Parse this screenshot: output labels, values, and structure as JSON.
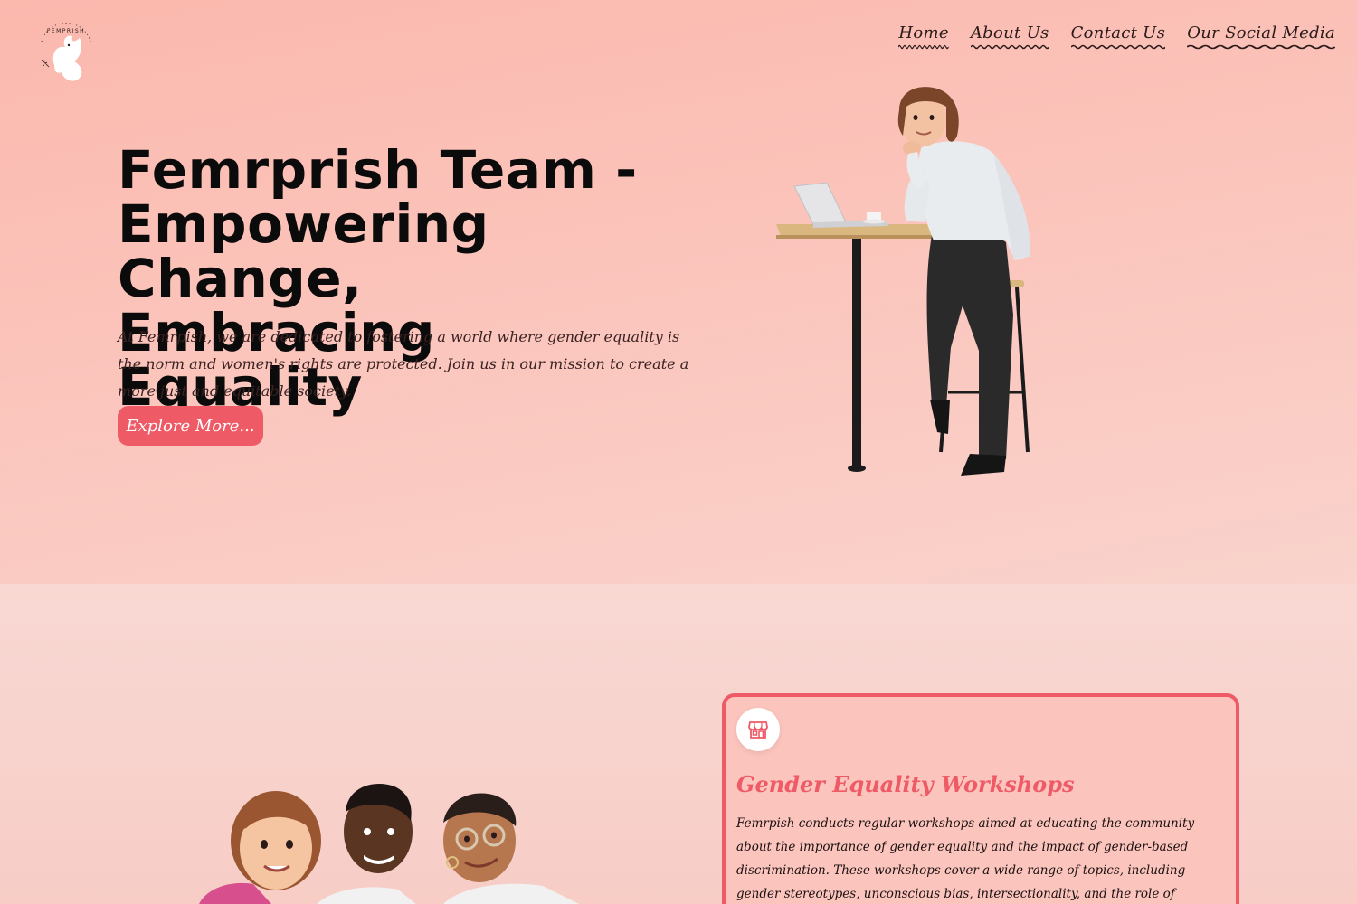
{
  "brand": {
    "logo_icon": "dove-icon",
    "logo_text": "FEMPRISH"
  },
  "nav": {
    "items": [
      {
        "label": "Home"
      },
      {
        "label": "About Us"
      },
      {
        "label": "Contact Us"
      },
      {
        "label": "Our Social Media"
      }
    ]
  },
  "hero": {
    "title_line1": "Femrprish Team -",
    "title_line2": "Empowering Change,",
    "title_line3": "Embracing Equality",
    "description": "At Femrpish, we are dedicated to fostering a world where gender equality is the norm and women's rights are protected. Join us in our mission to create a more just and equitable society.",
    "button_label": "Explore More..."
  },
  "card": {
    "icon": "store-icon",
    "title": "Gender Equality Workshops",
    "text": "Femrpish conducts regular workshops aimed at educating the community about the importance of gender equality and the impact of gender-based discrimination. These workshops cover a wide range of topics, including gender stereotypes, unconscious bias, intersectionality, and the role of feminism in creating a more inclusive society."
  },
  "colors": {
    "accent": "#ee5a66",
    "hero_bg": "#fbb8ad",
    "lower_bg": "#f9d8d3"
  }
}
